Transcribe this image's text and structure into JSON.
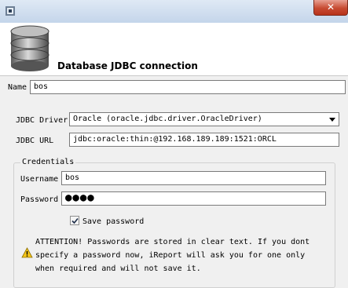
{
  "window": {
    "title": "",
    "close_label": "✕"
  },
  "header": {
    "title": "Database JDBC connection"
  },
  "form": {
    "name_label": "Name",
    "name_value": "bos",
    "driver_label": "JDBC Driver",
    "driver_value": "Oracle (oracle.jdbc.driver.OracleDriver)",
    "url_label": "JDBC URL",
    "url_value": "jdbc:oracle:thin:@192.168.189.189:1521:ORCL"
  },
  "credentials": {
    "legend": "Credentials",
    "username_label": "Username",
    "username_value": "bos",
    "password_label": "Password",
    "password_value": "●●●●",
    "save_password_label": "Save password",
    "save_password_checked": true
  },
  "warning": {
    "line1": "ATTENTION! Passwords are stored in clear text. If you dont",
    "line2": "specify a password now, iReport will ask you for one only",
    "line3": "when required and will not save it."
  }
}
